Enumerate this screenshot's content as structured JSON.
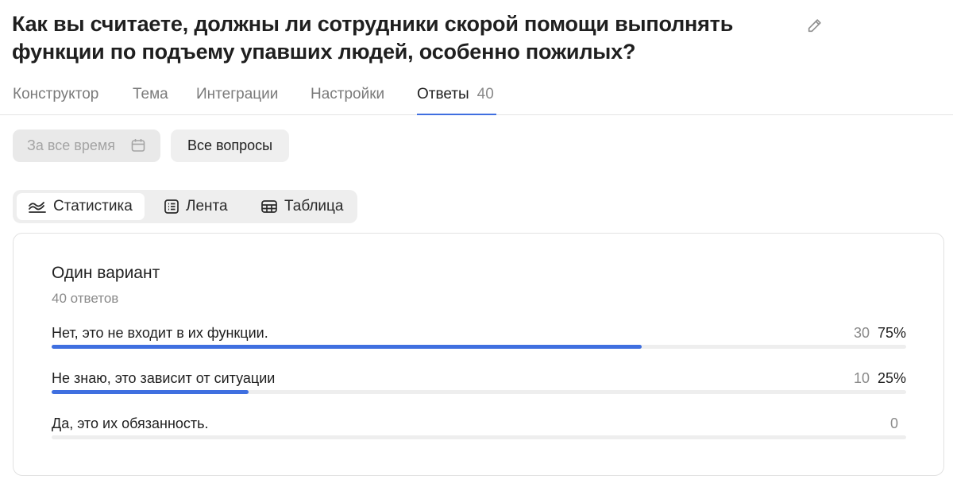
{
  "header": {
    "title": "Как вы считаете, должны ли сотрудники скорой помощи выполнять функции по подъему упавших людей, особенно пожилых?"
  },
  "tabs": [
    {
      "label": "Конструктор",
      "count": ""
    },
    {
      "label": "Тема",
      "count": ""
    },
    {
      "label": "Интеграции",
      "count": ""
    },
    {
      "label": "Настройки",
      "count": ""
    },
    {
      "label": "Ответы",
      "count": "40",
      "active": true
    }
  ],
  "filters": {
    "date_placeholder": "За все время",
    "questions_label": "Все вопросы"
  },
  "views": [
    {
      "label": "Статистика",
      "icon": "stats-icon",
      "active": true
    },
    {
      "label": "Лента",
      "icon": "list-icon"
    },
    {
      "label": "Таблица",
      "icon": "table-icon"
    }
  ],
  "question": {
    "title": "Один вариант",
    "subtitle": "40 ответов",
    "options": [
      {
        "label": "Нет, это не входит в их функции.",
        "count": "30",
        "percent": "75%",
        "fraction": 0.75
      },
      {
        "label": "Не знаю, это зависит от ситуации",
        "count": "10",
        "percent": "25%",
        "fraction": 0.25
      },
      {
        "label": "Да, это их обязанность.",
        "count": "0",
        "percent": "",
        "fraction": 0
      }
    ]
  },
  "colors": {
    "accent": "#3f6fe0",
    "track": "#eeeeee"
  }
}
